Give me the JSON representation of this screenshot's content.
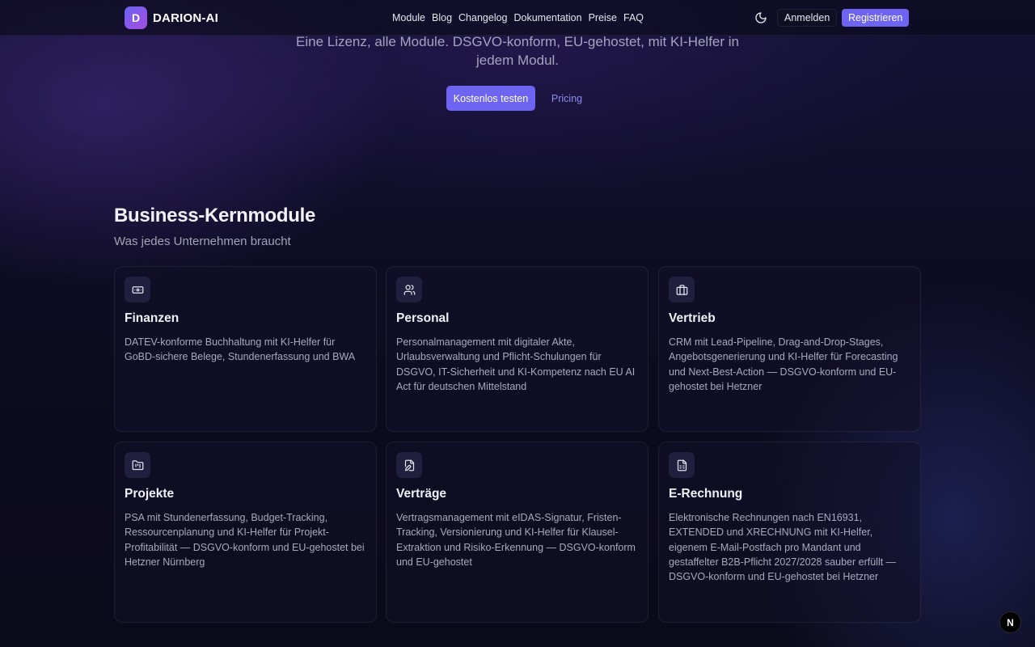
{
  "header": {
    "logo_letter": "D",
    "logo_text": "DARION-AI",
    "nav": [
      "Module",
      "Blog",
      "Changelog",
      "Dokumentation",
      "Preise",
      "FAQ"
    ],
    "login_label": "Anmelden",
    "register_label": "Registrieren"
  },
  "hero": {
    "subtitle": "Eine Lizenz, alle Module. DSGVO-konform, EU-gehostet, mit KI-Helfer in jedem Modul.",
    "cta_primary": "Kostenlos testen",
    "cta_secondary": "Pricing"
  },
  "section": {
    "title": "Business-Kernmodule",
    "subtitle": "Was jedes Unternehmen braucht"
  },
  "cards": [
    {
      "icon": "banknote-icon",
      "title": "Finanzen",
      "desc": "DATEV-konforme Buchhaltung mit KI-Helfer für GoBD-sichere Belege, Stundenerfassung und BWA"
    },
    {
      "icon": "users-icon",
      "title": "Personal",
      "desc": "Personalmanagement mit digitaler Akte, Urlaubsverwaltung und Pflicht-Schulungen für DSGVO, IT-Sicherheit und KI-Kompetenz nach EU AI Act für deutschen Mittelstand"
    },
    {
      "icon": "briefcase-icon",
      "title": "Vertrieb",
      "desc": "CRM mit Lead-Pipeline, Drag-and-Drop-Stages, Angebotsgenerierung und KI-Helfer für Forecasting und Next-Best-Action — DSGVO-konform und EU-gehostet bei Hetzner"
    },
    {
      "icon": "folder-kanban-icon",
      "title": "Projekte",
      "desc": "PSA mit Stundenerfassung, Budget-Tracking, Ressourcenplanung und KI-Helfer für Projekt-Profitabilität — DSGVO-konform und EU-gehostet bei Hetzner Nürnberg"
    },
    {
      "icon": "file-pen-icon",
      "title": "Verträge",
      "desc": "Vertragsmanagement mit eIDAS-Signatur, Fristen-Tracking, Versionierung und KI-Helfer für Klausel-Extraktion und Risiko-Erkennung — DSGVO-konform und EU-gehostet"
    },
    {
      "icon": "file-spreadsheet-icon",
      "title": "E-Rechnung",
      "desc": "Elektronische Rechnungen nach EN16931, EXTENDED und XRECHNUNG mit KI-Helfer, eigenem E-Mail-Postfach pro Mandant und gestaffelter B2B-Pflicht 2027/2028 sauber erfüllt — DSGVO-konform und EU-gehostet bei Hetzner"
    }
  ],
  "badge": "N",
  "colors": {
    "accent": "#6d64f1",
    "accent_link": "#8f8cf2",
    "background": "#0c0b1d"
  }
}
